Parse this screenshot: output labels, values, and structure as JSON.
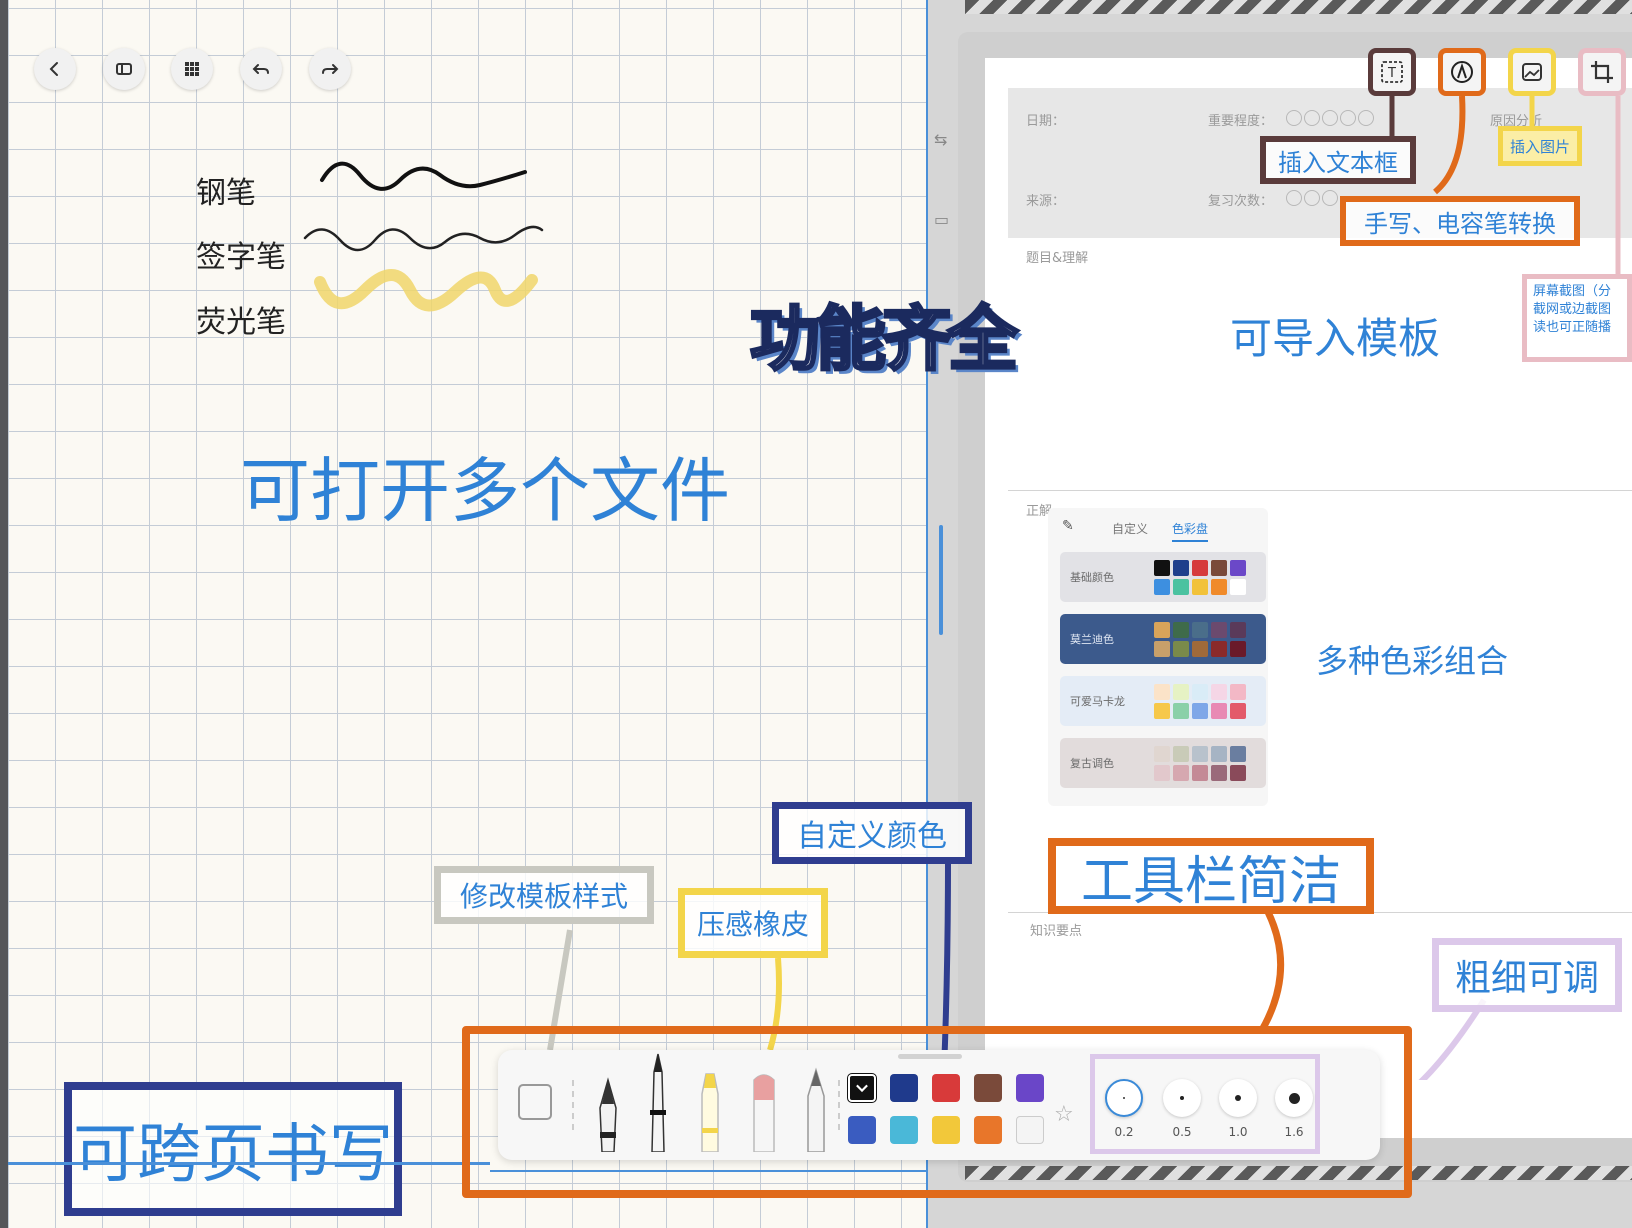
{
  "left_canvas": {
    "pens": {
      "fountain_pen": "钢笔",
      "signature_pen": "签字笔",
      "highlighter": "荧光笔"
    },
    "caption_multi_file": "可打开多个文件",
    "caption_cross_page": "可跨页书写",
    "nav_icons": [
      "back-icon",
      "sidebar-icon",
      "grid-icon",
      "undo-icon",
      "redo-icon"
    ]
  },
  "title_art": "功能齐全",
  "document": {
    "form": {
      "date_label": "日期：",
      "importance_label": "重要程度：",
      "analysis_label": "原因分析",
      "source_label": "来源：",
      "review_label": "复习次数：",
      "topic_label": "题目&理解",
      "correct_label": "正解",
      "knowledge_label": "知识要点"
    },
    "caption_template": "可导入模板",
    "caption_colors": "多种色彩组合"
  },
  "top_tools": {
    "icons": [
      "text-box-icon",
      "pen-mode-icon",
      "image-icon",
      "crop-icon"
    ],
    "annotation_text_box": "插入文本框",
    "annotation_pen_switch": "手写、电容笔转换",
    "annotation_image": "插入图片",
    "annotation_screenshot": [
      "屏幕截图（分",
      "截网或边截图",
      "读也可正随播"
    ]
  },
  "palette": {
    "tab_custom": "自定义",
    "tab_palette": "色彩盘",
    "rows": [
      {
        "name": "基础颜色",
        "colors": [
          "#111111",
          "#1f3f8c",
          "#d63b3b",
          "#7a4a3a",
          "#6b48c8",
          "#3d8fe0",
          "#4bc2a0",
          "#f2c23a",
          "#f08a2a",
          "#ffffff"
        ]
      },
      {
        "name": "莫兰迪色",
        "colors": [
          "#d9a45a",
          "#3f6b4a",
          "#4a6e8a",
          "#6b4a6e",
          "#5a3a5a",
          "#c8a06a",
          "#7a8a4a",
          "#a06a3a",
          "#8a2a2a",
          "#6a1a2a"
        ]
      },
      {
        "name": "可爱马卡龙",
        "colors": [
          "#fbe3c8",
          "#e6f2c4",
          "#d9ecf7",
          "#f5d6e6",
          "#f3b8c6",
          "#f6c84a",
          "#8ad0a8",
          "#7fa7e8",
          "#e88ab4",
          "#e35a6a"
        ]
      },
      {
        "name": "复古调色",
        "colors": [
          "#e0d6d0",
          "#c9cbb8",
          "#b8c2cc",
          "#a6b4c4",
          "#6a7ea0",
          "#e2c8cc",
          "#d6a8b0",
          "#c48a96",
          "#9a6a7a",
          "#8a4a5a"
        ]
      }
    ]
  },
  "annotations": {
    "toolbar_simple": "工具栏简洁",
    "custom_color": "自定义颜色",
    "modify_template": "修改模板样式",
    "pressure_eraser": "压感橡皮",
    "thickness_adjust": "粗细可调"
  },
  "toolbar": {
    "tool_icons": [
      "template-icon",
      "fountain-pen-icon",
      "ballpoint-pen-icon",
      "highlighter-icon",
      "eraser-icon",
      "pencil-icon",
      "favorite-icon"
    ],
    "swatches": [
      "#111111",
      "#1f3a8c",
      "#d83a3a",
      "#7a4a3a",
      "#6a46c8",
      "#3a5cc0",
      "#4ab8d8",
      "#f2c83a",
      "#e8762a",
      "#f4f4f4"
    ],
    "sizes": [
      "0.2",
      "0.5",
      "1.0",
      "1.6"
    ]
  },
  "colors": {
    "annotation_brown": "#5a3b3b",
    "annotation_orange": "#e06a1a",
    "annotation_yellow": "#f3d54a",
    "annotation_pink": "#e9bcc4",
    "annotation_navy": "#2f3d8f",
    "annotation_gray": "#c8c8c0",
    "annotation_lavender": "#dcc8ea",
    "caption_blue": "#2f82d6"
  }
}
